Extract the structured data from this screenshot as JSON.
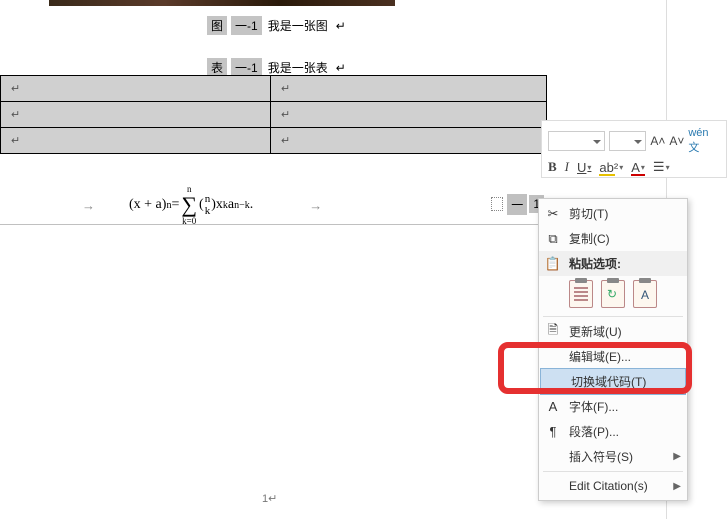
{
  "captions": {
    "fig_prefix": "图",
    "fig_num": "一-1",
    "fig_text": "我是一张图",
    "tbl_prefix": "表",
    "tbl_num": "一-1",
    "tbl_text": "我是一张表",
    "para_mark": "↵"
  },
  "table": {
    "cell": "↵"
  },
  "equation": {
    "lhs": "(x + a)",
    "lhs_exp": "n",
    "eq": " = ",
    "sum_top": "n",
    "sum_bot": "k=0",
    "binom_top": "n",
    "binom_bot": "k",
    "x": "x",
    "x_exp": "k",
    "a": "a",
    "a_exp": "n−k",
    "dash": "一",
    "one": "1",
    "arrow": "→"
  },
  "float_toolbar": {
    "font_up": "A˄",
    "font_dn": "A˅",
    "wen": "wén 文",
    "b": "B",
    "i": "I",
    "u": "U",
    "ab2": "ab²",
    "afill": "A",
    "list": "☰"
  },
  "context_menu": {
    "cut": "剪切(T)",
    "copy": "复制(C)",
    "paste_header": "粘贴选项:",
    "update_field": "更新域(U)",
    "edit_field": "编辑域(E)...",
    "toggle_field_code": "切换域代码(T)",
    "font": "字体(F)...",
    "paragraph": "段落(P)...",
    "insert_symbol": "插入符号(S)",
    "edit_citation": "Edit Citation(s)"
  },
  "icons": {
    "cut": "✂",
    "copy": "⧉",
    "paste": "📋",
    "update": "🗎",
    "font": "A",
    "paragraph": "¶"
  },
  "page_number": "1↵"
}
